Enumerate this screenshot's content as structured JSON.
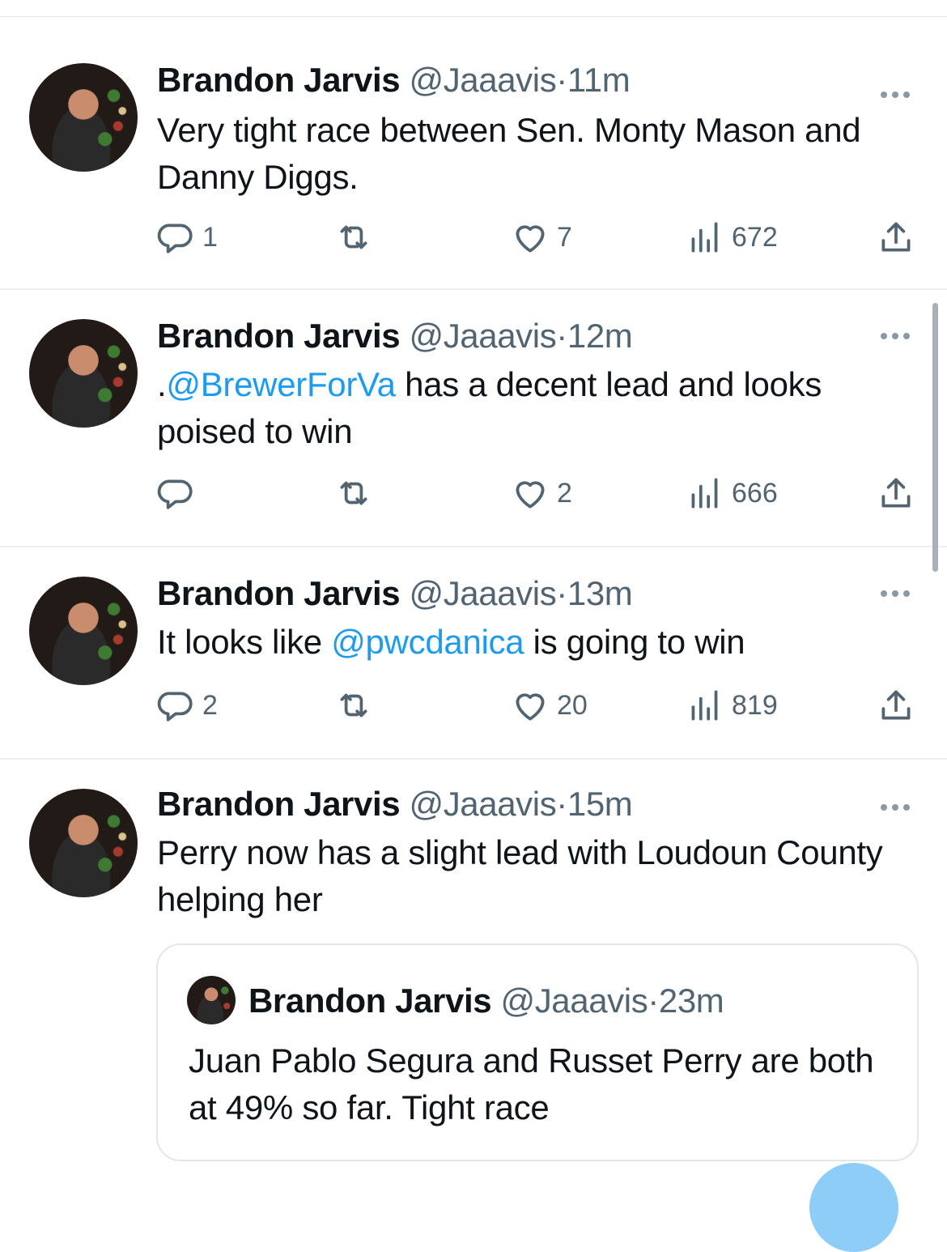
{
  "tweets": [
    {
      "name": "Brandon Jarvis",
      "handle": "@Jaaavis",
      "sep": "·",
      "time": "11m",
      "text_parts": [
        "Very tight race between Sen. Monty Mason and Danny Diggs."
      ],
      "reply_count": "1",
      "retweet_count": "",
      "like_count": "7",
      "view_count": "672"
    },
    {
      "name": "Brandon Jarvis",
      "handle": "@Jaaavis",
      "sep": "·",
      "time": "12m",
      "text_prefix": ".",
      "mention": "@BrewerForVa",
      "text_suffix": " has a decent lead and looks poised to win",
      "reply_count": "",
      "retweet_count": "",
      "like_count": "2",
      "view_count": "666"
    },
    {
      "name": "Brandon Jarvis",
      "handle": "@Jaaavis",
      "sep": "·",
      "time": "13m",
      "text_prefix": "It looks like ",
      "mention": "@pwcdanica",
      "text_suffix": " is going to win",
      "reply_count": "2",
      "retweet_count": "",
      "like_count": "20",
      "view_count": "819"
    },
    {
      "name": "Brandon Jarvis",
      "handle": "@Jaaavis",
      "sep": "·",
      "time": "15m",
      "text": "Perry now has a slight lead with Loudoun County helping her",
      "quote": {
        "name": "Brandon Jarvis",
        "handle": "@Jaaavis",
        "sep": "·",
        "time": "23m",
        "text": "Juan Pablo Segura and Russet Perry are both at 49% so far. Tight race"
      }
    }
  ],
  "icons": {
    "reply": "reply-icon",
    "retweet": "retweet-icon",
    "like": "heart-icon",
    "views": "views-icon",
    "share": "share-icon",
    "more": "more-icon"
  },
  "colors": {
    "link": "#1d9bf0",
    "secondary_text": "#536471",
    "primary_text": "#0f1419"
  }
}
